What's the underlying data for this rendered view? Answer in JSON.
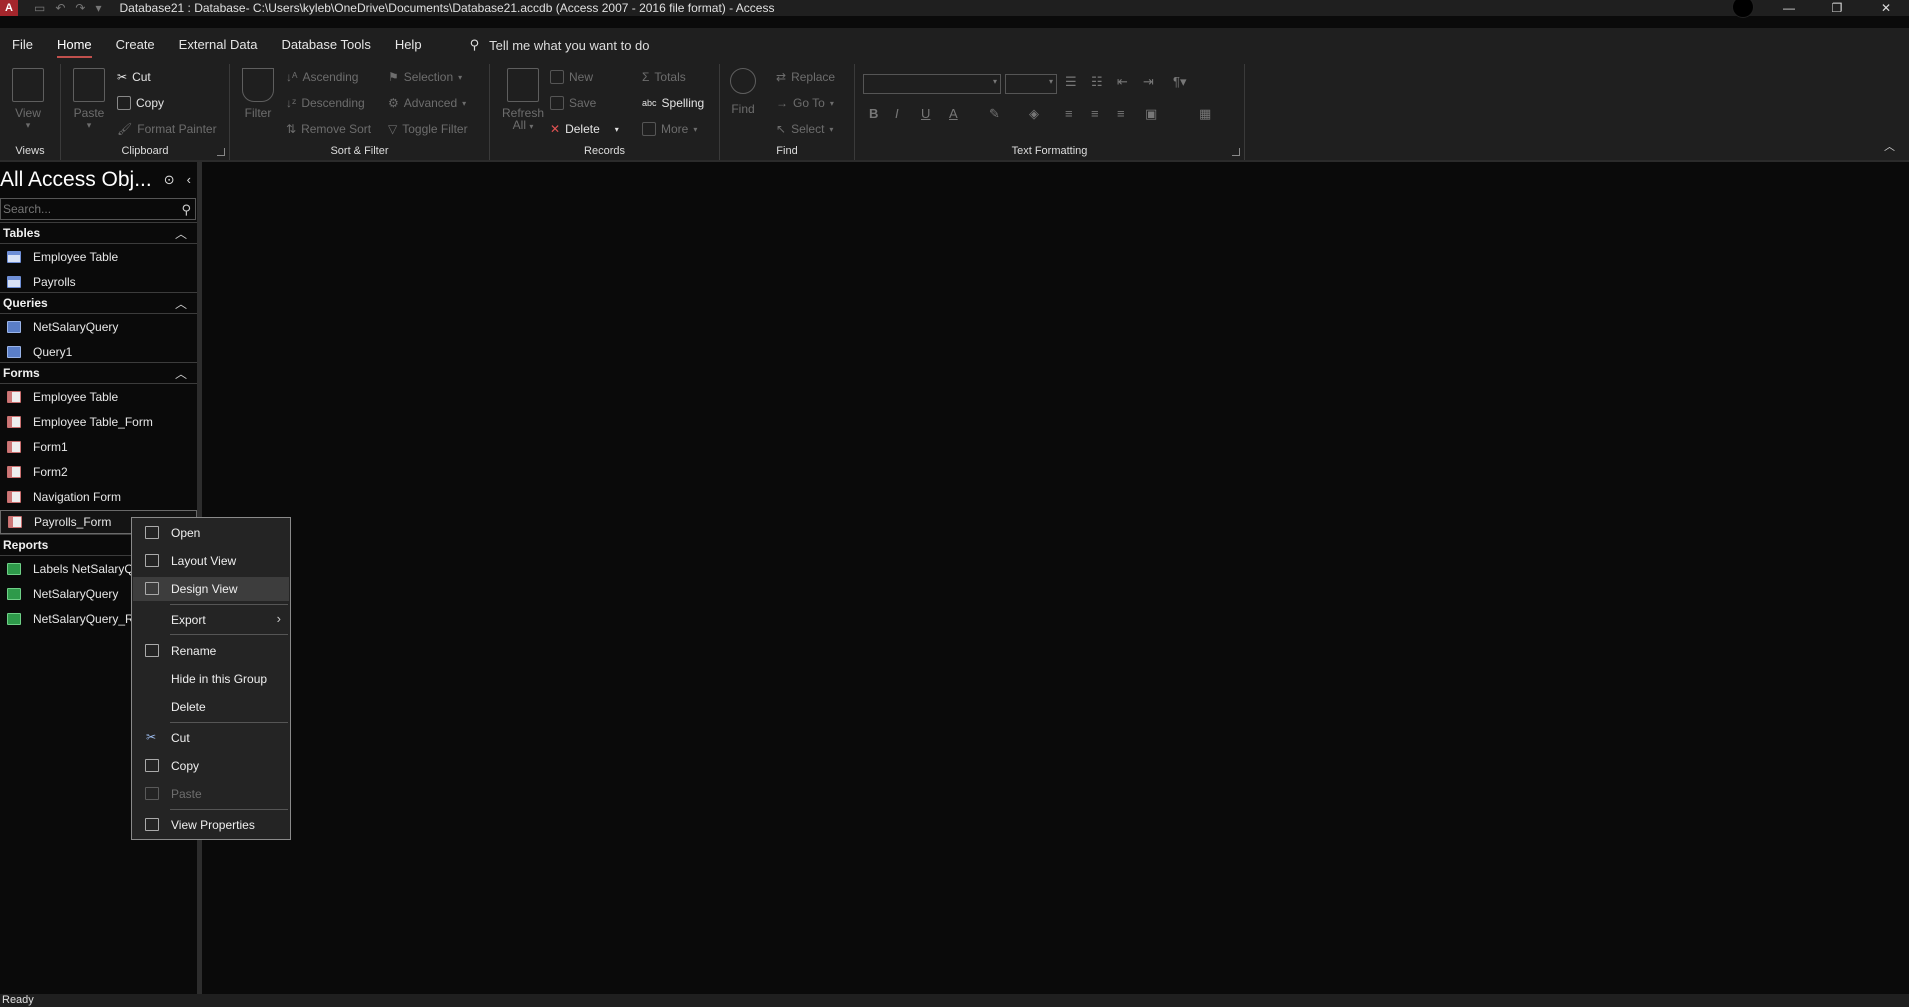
{
  "titlebar": {
    "app_letter": "A",
    "title": "Database21 : Database- C:\\Users\\kyleb\\OneDrive\\Documents\\Database21.accdb (Access 2007 - 2016 file format)  -  Access",
    "minimize": "—",
    "restore": "❐",
    "close": "✕"
  },
  "menu": {
    "tabs": [
      "File",
      "Home",
      "Create",
      "External Data",
      "Database Tools",
      "Help"
    ],
    "active": "Home",
    "tell_me": "Tell me what you want to do"
  },
  "ribbon": {
    "views": {
      "label": "Views",
      "view": "View"
    },
    "clipboard": {
      "label": "Clipboard",
      "paste": "Paste",
      "cut": "Cut",
      "copy": "Copy",
      "format_painter": "Format Painter"
    },
    "sort_filter": {
      "label": "Sort & Filter",
      "filter": "Filter",
      "ascending": "Ascending",
      "descending": "Descending",
      "remove_sort": "Remove Sort",
      "selection": "Selection",
      "advanced": "Advanced",
      "toggle_filter": "Toggle Filter"
    },
    "records": {
      "label": "Records",
      "refresh": "Refresh",
      "refresh_sub": "All",
      "new": "New",
      "save": "Save",
      "delete": "Delete",
      "totals": "Totals",
      "spelling": "Spelling",
      "more": "More"
    },
    "find": {
      "label": "Find",
      "find": "Find",
      "replace": "Replace",
      "goto": "Go To",
      "select": "Select"
    },
    "text_formatting": {
      "label": "Text Formatting",
      "bold": "B",
      "italic": "I",
      "underline": "U",
      "font_color": "A"
    }
  },
  "nav": {
    "title": "All Access Obj...",
    "search_placeholder": "Search...",
    "sections": [
      {
        "name": "Tables",
        "items": [
          "Employee Table",
          "Payrolls"
        ]
      },
      {
        "name": "Queries",
        "items": [
          "NetSalaryQuery",
          "Query1"
        ]
      },
      {
        "name": "Forms",
        "items": [
          "Employee Table",
          "Employee Table_Form",
          "Form1",
          "Form2",
          "Navigation Form",
          "Payrolls_Form"
        ]
      },
      {
        "name": "Reports",
        "items": [
          "Labels NetSalaryQuery",
          "NetSalaryQuery",
          "NetSalaryQuery_Report"
        ]
      }
    ],
    "selected": "Payrolls_Form"
  },
  "context_menu": {
    "items": [
      {
        "label": "Open",
        "icon": "open-icon"
      },
      {
        "label": "Layout View",
        "icon": "layout-view-icon"
      },
      {
        "label": "Design View",
        "icon": "design-view-icon",
        "hover": true
      },
      {
        "label": "Export",
        "submenu": true
      },
      {
        "label": "Rename",
        "icon": "rename-icon"
      },
      {
        "label": "Hide in this Group"
      },
      {
        "label": "Delete"
      },
      {
        "label": "Cut",
        "icon": "scissors-icon"
      },
      {
        "label": "Copy",
        "icon": "copy-icon"
      },
      {
        "label": "Paste",
        "icon": "paste-icon",
        "disabled": true
      },
      {
        "label": "View Properties",
        "icon": "properties-icon"
      }
    ]
  },
  "status": {
    "text": "Ready"
  },
  "colors": {
    "background": "#0a0a0a",
    "chrome": "#1f1f1f",
    "accent": "#c0504d"
  }
}
